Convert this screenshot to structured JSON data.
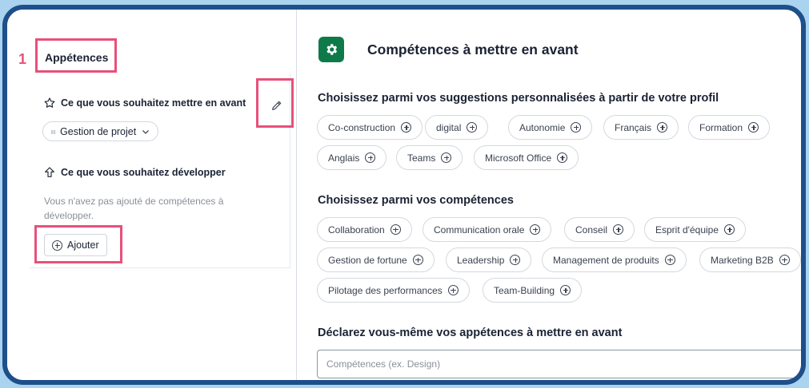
{
  "annotation": {
    "step_number": "1",
    "highlight_color": "#e8507a"
  },
  "left": {
    "title": "Appétences",
    "highlight": {
      "section_head": "Ce que vous souhaitez mettre en avant",
      "selected_skill": "Gestion de projet",
      "develop_head": "Ce que vous souhaitez développer",
      "empty_text": "Vous n'avez pas ajouté de compétences à développer.",
      "add_label": "Ajouter"
    }
  },
  "right": {
    "title": "Compétences à mettre en avant",
    "accent_color": "#0f7a49",
    "suggestions": {
      "heading": "Choisissez parmi vos suggestions personnalisées à partir de votre profil",
      "chips": [
        "Co-construction",
        "digital",
        "Autonomie",
        "Français",
        "Formation",
        "Anglais",
        "Teams",
        "Microsoft Office"
      ]
    },
    "skills": {
      "heading": "Choisissez parmi vos compétences",
      "chips": [
        "Collaboration",
        "Communication orale",
        "Conseil",
        "Esprit d'équipe",
        "Gestion de fortune",
        "Leadership",
        "Management de produits",
        "Marketing B2B",
        "Pilotage des performances",
        "Team-Building"
      ]
    },
    "declare": {
      "heading": "Déclarez vous-même vos appétences à mettre en avant",
      "placeholder": "Compétences (ex. Design)"
    }
  }
}
